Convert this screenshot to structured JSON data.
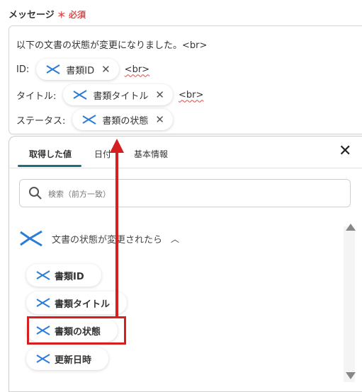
{
  "field": {
    "label": "メッセージ",
    "required_mark": "＊",
    "required_text": "必須"
  },
  "message": {
    "line1": "以下の文書の状態が変更になりました。<br>",
    "line2_prefix": "ID:",
    "line2_chip": "書類ID",
    "line3_prefix": "タイトル:",
    "line3_chip": "書類タイトル",
    "line4_prefix": "ステータス:",
    "line4_chip": "書類の状態",
    "br": "<br>",
    "close_glyph": "✕"
  },
  "panel": {
    "tabs": [
      "取得した値",
      "日付",
      "基本情報"
    ],
    "active_tab": 0,
    "close_glyph": "✕",
    "search_placeholder": "検索（前方一致）",
    "group_title": "文書の状態が変更されたら",
    "group_chevron": "︿",
    "items": [
      "書類ID",
      "書類タイトル",
      "書類の状態",
      "更新日時"
    ],
    "highlighted_item": 2
  },
  "colors": {
    "accent": "#1c6d82",
    "highlight": "#d42020",
    "required": "#e04a4a",
    "icon_blue": "#2b7bd8"
  },
  "icons": {
    "chip": "app-logo-icon",
    "search": "search-icon",
    "close": "close-icon",
    "remove": "remove-icon"
  }
}
